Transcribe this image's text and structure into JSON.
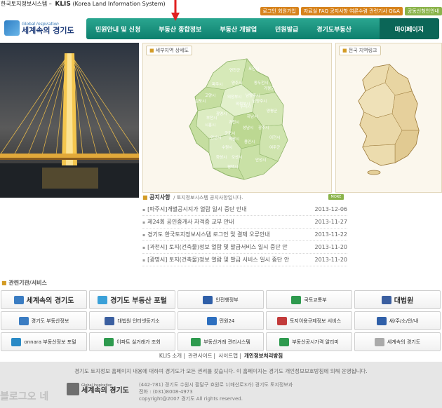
{
  "header": {
    "site_title": "한국토지정보시스템 –",
    "site_abbr": "KLIS",
    "site_en": "(Korea Land Information System)",
    "logo_sub": "Global Inspiration",
    "logo_main": "세계속의 경기도"
  },
  "util": {
    "login": "로그인 회원가입",
    "links": "자료실 FAQ 공지사항 여론수렴 관련기사 Q&A",
    "intro": "공동신청인안내"
  },
  "nav": {
    "items": [
      "민원안내 및 신청",
      "부동산 종합정보",
      "부동산 개발업",
      "민원발급",
      "경기도부동산"
    ],
    "mypage": "마이페이지"
  },
  "panels": {
    "regional_map": "세부지역 상세도",
    "national_map": "전국 지역링크"
  },
  "map_labels": [
    "연천군",
    "포천시",
    "파주시",
    "양주시",
    "동두천시",
    "가평군",
    "고양시",
    "의정부시",
    "남양주시",
    "김포시",
    "구리시",
    "양평군",
    "부천시",
    "하남시",
    "광명시",
    "광주시",
    "시흥시",
    "과천시",
    "성남시",
    "안산시",
    "군포시",
    "의왕시",
    "수원시",
    "용인시",
    "이천시",
    "여주군",
    "화성시",
    "오산시",
    "평택시",
    "안성시",
    "의정부시",
    "남양주시"
  ],
  "notices": {
    "title": "공지사항",
    "subtitle": "/ 토지정보시스템 공지사항입니다.",
    "more": "MORE",
    "items": [
      {
        "title": "[파주시]개별공시지가 열람 일시 중단 안내",
        "date": "2013-12-06"
      },
      {
        "title": "제24회 공인중개사 자격증 교부 안내",
        "date": "2013-11-27"
      },
      {
        "title": "경기도 한국토지정보시스템 로그인 및 결제 오류안내",
        "date": "2013-11-22"
      },
      {
        "title": "[과천시] 토지(건축물)정보 열람 및 발급서비스 일시 중단 안",
        "date": "2013-11-20"
      },
      {
        "title": "[광명시] 토지(건축물)정보 열람 및 발급 서비스 일시 중단 안",
        "date": "2013-11-20"
      }
    ]
  },
  "related": {
    "title": "관련기관/서비스",
    "items": [
      {
        "label": "세계속의 경기도",
        "color": "#3a7cc2"
      },
      {
        "label": "경기도 부동산 포털",
        "color": "#3aa0d8"
      },
      {
        "label": "안전행정부",
        "color": "#2f5fa8"
      },
      {
        "label": "국토교통부",
        "color": "#2e9a4e"
      },
      {
        "label": "대법원",
        "color": "#3b5fa0"
      },
      {
        "label": "경기도 부동산정보",
        "color": "#3a7cc2"
      },
      {
        "label": "대법원 인터넷등기소",
        "color": "#3b5fa0"
      },
      {
        "label": "민원24",
        "color": "#2d6fbf"
      },
      {
        "label": "토지이용규제정보 서비스",
        "color": "#c23a3a"
      },
      {
        "label": "새/주/소/안/내",
        "color": "#2f5fa8"
      },
      {
        "label": "onnara 부동산정보 포털",
        "color": "#2a8ac6"
      },
      {
        "label": "이파트 실거래가 조회",
        "color": "#2e9a4e"
      },
      {
        "label": "부동산거래 관리시스템",
        "color": "#2e9a4e"
      },
      {
        "label": "부동산공시가격 알리미",
        "color": "#2e9a4e"
      },
      {
        "label": "세계속의 경기도",
        "color": "#aaaaaa"
      }
    ]
  },
  "footer": {
    "links": [
      "KLIS 소개",
      "관련사이트",
      "사이트맵",
      "개인정보처리방침"
    ],
    "notice": "경기도 토지정보 홈페이지 내용에 대하여 경기도가 모든 권리를 갖습니다. 이 홈페이지는 경기도 개인정보보호방침에 의해 운영됩니다.",
    "logo_sub": "Global Inspiration",
    "logo_main": "세계속의 경기도",
    "address": "(442-781) 경기도 수원시 팔달구 효원로 1(매산로3가) 경기도 토지정보과",
    "phone": "전화 : (031)8008-4973",
    "copyright": "copyright@2007 경기도 All rights reserved."
  },
  "watermark": "블로그오 네"
}
